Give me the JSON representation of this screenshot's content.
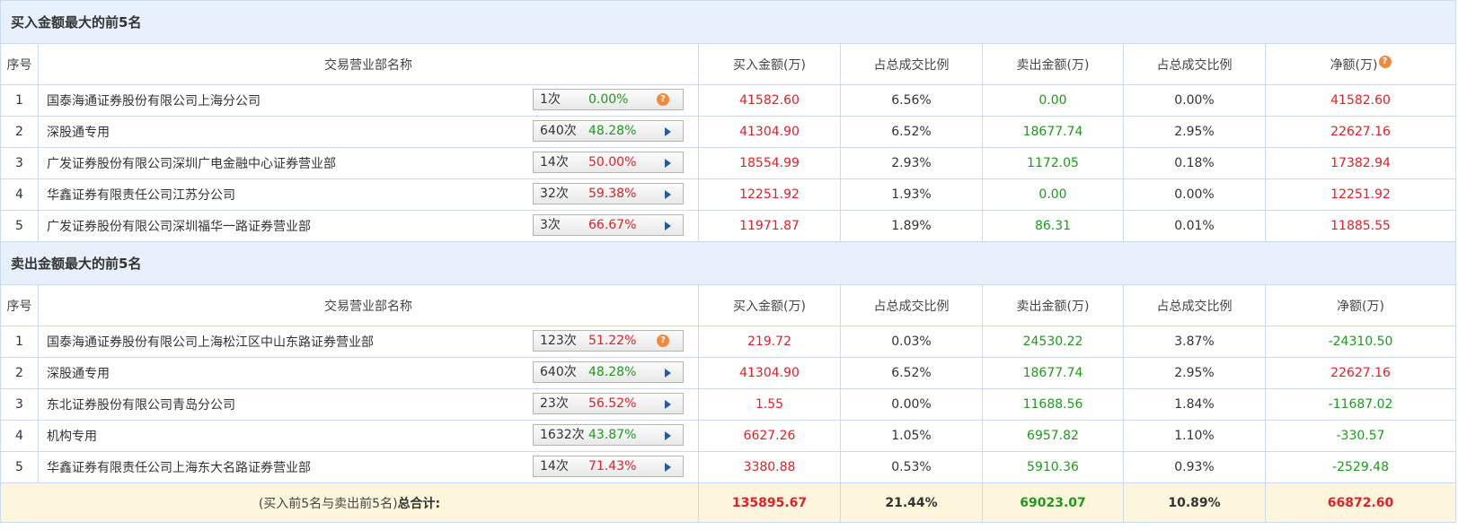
{
  "columns": {
    "seq": "序号",
    "name": "交易营业部名称",
    "buy": "买入金额(万)",
    "buy_ratio": "占总成交比例",
    "sell": "卖出金额(万)",
    "sell_ratio": "占总成交比例",
    "net": "净额(万)"
  },
  "help_glyph": "?",
  "buy_section": {
    "title": "买入金额最大的前5名",
    "rows": [
      {
        "seq": "1",
        "name": "国泰海通证券股份有限公司上海分公司",
        "count": "1次",
        "pct": "0.00%",
        "pct_color": "green",
        "pill_icon": "help-icon",
        "buy": "41582.60",
        "buy_ratio": "6.56%",
        "sell": "0.00",
        "sell_ratio": "0.00%",
        "net": "41582.60",
        "net_color": "red"
      },
      {
        "seq": "2",
        "name": "深股通专用",
        "count": "640次",
        "pct": "48.28%",
        "pct_color": "green",
        "pill_icon": "arrow-right-icon",
        "buy": "41304.90",
        "buy_ratio": "6.52%",
        "sell": "18677.74",
        "sell_ratio": "2.95%",
        "net": "22627.16",
        "net_color": "red"
      },
      {
        "seq": "3",
        "name": "广发证券股份有限公司深圳广电金融中心证券营业部",
        "count": "14次",
        "pct": "50.00%",
        "pct_color": "red",
        "pill_icon": "arrow-right-icon",
        "buy": "18554.99",
        "buy_ratio": "2.93%",
        "sell": "1172.05",
        "sell_ratio": "0.18%",
        "net": "17382.94",
        "net_color": "red"
      },
      {
        "seq": "4",
        "name": "华鑫证券有限责任公司江苏分公司",
        "count": "32次",
        "pct": "59.38%",
        "pct_color": "red",
        "pill_icon": "arrow-right-icon",
        "buy": "12251.92",
        "buy_ratio": "1.93%",
        "sell": "0.00",
        "sell_ratio": "0.00%",
        "net": "12251.92",
        "net_color": "red"
      },
      {
        "seq": "5",
        "name": "广发证券股份有限公司深圳福华一路证券营业部",
        "count": "3次",
        "pct": "66.67%",
        "pct_color": "red",
        "pill_icon": "arrow-right-icon",
        "buy": "11971.87",
        "buy_ratio": "1.89%",
        "sell": "86.31",
        "sell_ratio": "0.01%",
        "net": "11885.55",
        "net_color": "red"
      }
    ]
  },
  "sell_section": {
    "title": "卖出金额最大的前5名",
    "rows": [
      {
        "seq": "1",
        "name": "国泰海通证券股份有限公司上海松江区中山东路证券营业部",
        "count": "123次",
        "pct": "51.22%",
        "pct_color": "red",
        "pill_icon": "help-icon",
        "buy": "219.72",
        "buy_ratio": "0.03%",
        "sell": "24530.22",
        "sell_ratio": "3.87%",
        "net": "-24310.50",
        "net_color": "green"
      },
      {
        "seq": "2",
        "name": "深股通专用",
        "count": "640次",
        "pct": "48.28%",
        "pct_color": "green",
        "pill_icon": "arrow-right-icon",
        "buy": "41304.90",
        "buy_ratio": "6.52%",
        "sell": "18677.74",
        "sell_ratio": "2.95%",
        "net": "22627.16",
        "net_color": "red"
      },
      {
        "seq": "3",
        "name": "东北证券股份有限公司青岛分公司",
        "count": "23次",
        "pct": "56.52%",
        "pct_color": "red",
        "pill_icon": "arrow-right-icon",
        "buy": "1.55",
        "buy_ratio": "0.00%",
        "sell": "11688.56",
        "sell_ratio": "1.84%",
        "net": "-11687.02",
        "net_color": "green"
      },
      {
        "seq": "4",
        "name": "机构专用",
        "count": "1632次",
        "pct": "43.87%",
        "pct_color": "green",
        "pill_icon": "arrow-right-icon",
        "buy": "6627.26",
        "buy_ratio": "1.05%",
        "sell": "6957.82",
        "sell_ratio": "1.10%",
        "net": "-330.57",
        "net_color": "green"
      },
      {
        "seq": "5",
        "name": "华鑫证券有限责任公司上海东大名路证券营业部",
        "count": "14次",
        "pct": "71.43%",
        "pct_color": "red",
        "pill_icon": "arrow-right-icon",
        "buy": "3380.88",
        "buy_ratio": "0.53%",
        "sell": "5910.36",
        "sell_ratio": "0.93%",
        "net": "-2529.48",
        "net_color": "green"
      }
    ]
  },
  "total": {
    "label_prefix": "(买入前5名与卖出前5名)",
    "label_bold": "总合计:",
    "buy": "135895.67",
    "buy_ratio": "21.44%",
    "sell": "69023.07",
    "sell_ratio": "10.89%",
    "net": "66872.60"
  }
}
